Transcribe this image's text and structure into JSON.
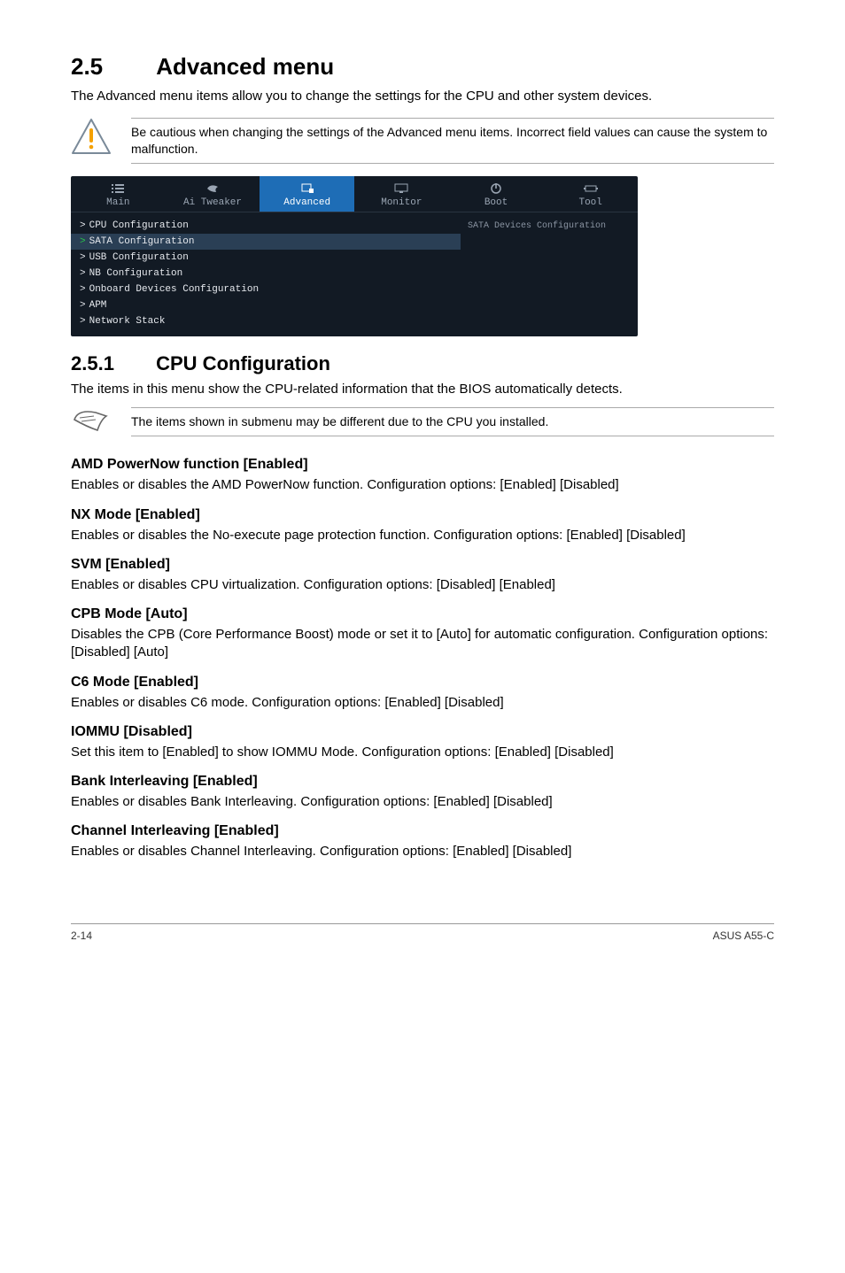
{
  "section": {
    "num": "2.5",
    "title": "Advanced menu"
  },
  "intro": "The Advanced menu items allow you to change the settings for the CPU and other system devices.",
  "warning": "Be cautious when changing the settings of the Advanced menu items. Incorrect field values can cause the system to malfunction.",
  "bios": {
    "tabs": [
      "Main",
      "Ai Tweaker",
      "Advanced",
      "Monitor",
      "Boot",
      "Tool"
    ],
    "active_tab": "Advanced",
    "items": [
      "CPU Configuration",
      "SATA Configuration",
      "USB Configuration",
      "NB Configuration",
      "Onboard Devices Configuration",
      "APM",
      "Network Stack"
    ],
    "selected": "SATA Configuration",
    "help": "SATA Devices Configuration"
  },
  "subsection": {
    "num": "2.5.1",
    "title": "CPU Configuration"
  },
  "subsection_intro": "The items in this menu show the CPU-related information that the BIOS automatically detects.",
  "note": "The items shown in submenu may be different due to the CPU you installed.",
  "settings": [
    {
      "title": "AMD PowerNow function [Enabled]",
      "body": "Enables or disables the AMD PowerNow function. Configuration options: [Enabled] [Disabled]"
    },
    {
      "title": "NX Mode [Enabled]",
      "body": "Enables or disables the No-execute page protection function. Configuration options: [Enabled] [Disabled]"
    },
    {
      "title": "SVM [Enabled]",
      "body": "Enables or disables CPU virtualization. Configuration options: [Disabled] [Enabled]"
    },
    {
      "title": "CPB Mode [Auto]",
      "body": "Disables the CPB (Core Performance Boost) mode or set it to [Auto] for automatic configuration. Configuration options: [Disabled] [Auto]"
    },
    {
      "title": "C6 Mode [Enabled]",
      "body": "Enables or disables C6 mode. Configuration options: [Enabled] [Disabled]"
    },
    {
      "title": "IOMMU [Disabled]",
      "body": "Set this item to [Enabled] to show IOMMU Mode. Configuration options: [Enabled] [Disabled]"
    },
    {
      "title": "Bank Interleaving [Enabled]",
      "body": "Enables or disables Bank Interleaving. Configuration options: [Enabled] [Disabled]"
    },
    {
      "title": "Channel Interleaving [Enabled]",
      "body": "Enables or disables Channel Interleaving. Configuration options: [Enabled] [Disabled]"
    }
  ],
  "footer": {
    "left": "2-14",
    "right": "ASUS A55-C"
  }
}
